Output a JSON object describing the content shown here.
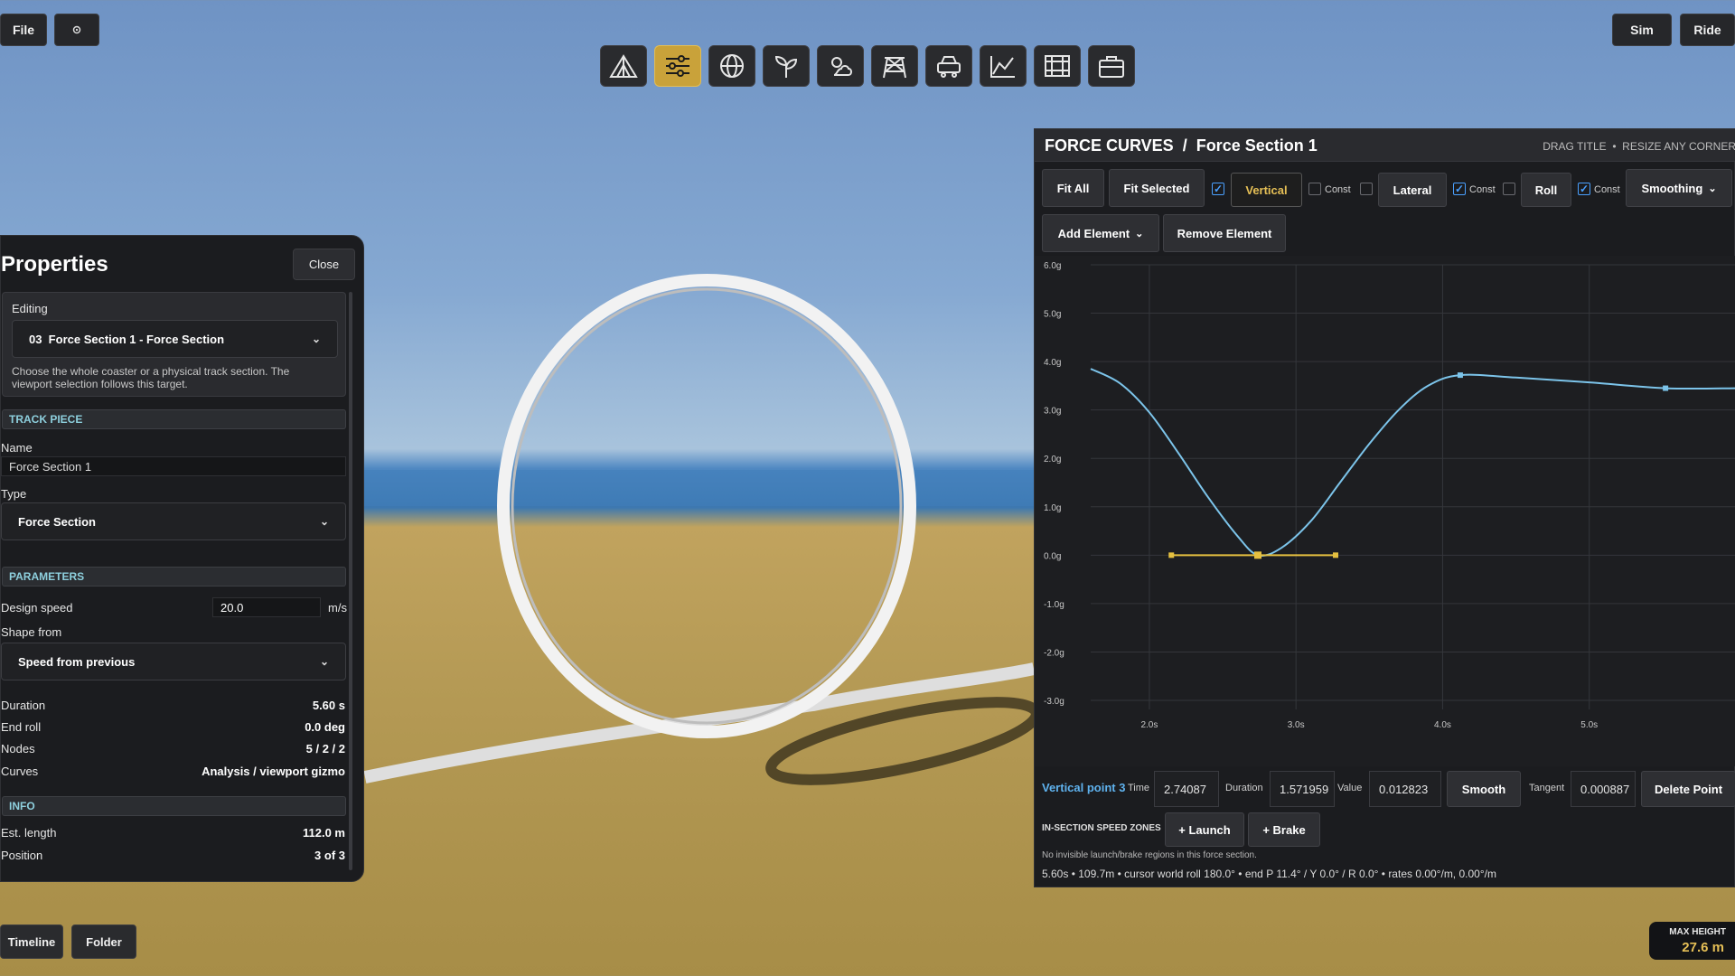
{
  "top": {
    "file_label": "File",
    "sim_label": "Sim",
    "ride_label": "Ride",
    "settings_icon": "gear-icon"
  },
  "toolbar": {
    "tools": [
      {
        "icon": "tent-icon",
        "active": false
      },
      {
        "icon": "sliders-icon",
        "active": true
      },
      {
        "icon": "globe-icon",
        "active": false
      },
      {
        "icon": "plant-icon",
        "active": false
      },
      {
        "icon": "weather-icon",
        "active": false
      },
      {
        "icon": "tower-icon",
        "active": false
      },
      {
        "icon": "car-icon",
        "active": false
      },
      {
        "icon": "graph-icon",
        "active": false
      },
      {
        "icon": "film-icon",
        "active": false
      },
      {
        "icon": "toolbox-icon",
        "active": false
      }
    ],
    "accent": "#c9a23a"
  },
  "properties": {
    "title": "Properties",
    "close_label": "Close",
    "editing_label": "Editing",
    "editing_value": "03  Force Section 1 - Force Section",
    "editing_help": "Choose the whole coaster or a physical track section. The viewport selection follows this target.",
    "track_piece_header": "TRACK PIECE",
    "name_label": "Name",
    "name_value": "Force Section 1",
    "type_label": "Type",
    "type_value": "Force Section",
    "parameters_header": "PARAMETERS",
    "design_speed_label": "Design speed",
    "design_speed_value": "20.0",
    "design_speed_unit": "m/s",
    "shape_from_label": "Shape from",
    "shape_from_value": "Speed from previous",
    "stats": [
      {
        "label": "Duration",
        "value": "5.60 s"
      },
      {
        "label": "End roll",
        "value": "0.0 deg"
      },
      {
        "label": "Nodes",
        "value": "5 / 2 / 2"
      },
      {
        "label": "Curves",
        "value": "Analysis / viewport gizmo"
      }
    ],
    "info_header": "INFO",
    "info": [
      {
        "label": "Est. length",
        "value": "112.0 m"
      },
      {
        "label": "Position",
        "value": "3 of 3"
      }
    ],
    "header_color": "#8ed0de"
  },
  "force_curves": {
    "title": "FORCE CURVES  /  Force Section 1",
    "hint": "DRAG TITLE  •  RESIZE ANY CORNER",
    "fit_all": "Fit All",
    "fit_selected": "Fit Selected",
    "vertical": "Vertical",
    "lateral": "Lateral",
    "roll": "Roll",
    "const": "Const",
    "smoothing": "Smoothing",
    "add_element": "Add Element",
    "remove_element": "Remove Element",
    "checks": {
      "vertical": true,
      "vertical_const": false,
      "lateral": false,
      "lateral_const": true,
      "roll": false,
      "roll_const": true
    },
    "point_label": "Vertical point 3",
    "time_label": "Time",
    "time_value": "2.74087",
    "duration_label": "Duration",
    "duration_value": "1.571959",
    "value_label": "Value",
    "value_value": "0.012823",
    "smooth_label": "Smooth",
    "tangent_label": "Tangent",
    "tangent_value": "0.000887",
    "delete_point": "Delete Point",
    "speed_zones_label": "IN-SECTION SPEED ZONES",
    "launch_label": "+ Launch",
    "brake_label": "+ Brake",
    "no_regions": "No invisible launch/brake regions in this force section.",
    "status_line": "5.60s • 109.7m • cursor world roll 180.0° • end P 11.4° / Y 0.0° / R 0.0° • rates 0.00°/m, 0.00°/m",
    "curve_color": "#7cc4ea",
    "tangent_color": "#e5c040"
  },
  "chart_data": {
    "type": "line",
    "series": [
      {
        "x": [
          1.6,
          1.8,
          2.0,
          2.2,
          2.4,
          2.6,
          2.74,
          2.9,
          3.1,
          3.3,
          3.5,
          3.7,
          3.9,
          4.12,
          4.5,
          5.0,
          5.52,
          6.0
        ],
        "values": [
          3.85,
          3.55,
          2.95,
          2.1,
          1.2,
          0.4,
          0.0,
          0.15,
          0.7,
          1.5,
          2.3,
          3.0,
          3.5,
          3.72,
          3.67,
          3.57,
          3.45,
          3.45
        ]
      }
    ],
    "points": [
      {
        "x": 2.74,
        "y": 0.0,
        "selected": true
      },
      {
        "x": 4.12,
        "y": 3.72,
        "selected": false
      },
      {
        "x": 5.52,
        "y": 3.45,
        "selected": false
      }
    ],
    "tangent_handles": [
      {
        "x": 2.15,
        "y": 0.0
      },
      {
        "x": 3.27,
        "y": 0.0
      }
    ],
    "xticks": [
      "2.0s",
      "3.0s",
      "4.0s",
      "5.0s"
    ],
    "xtick_values": [
      2.0,
      3.0,
      4.0,
      5.0
    ],
    "yticks": [
      "6.0g",
      "5.0g",
      "4.0g",
      "3.0g",
      "2.0g",
      "1.0g",
      "0.0g",
      "-1.0g",
      "-2.0g",
      "-3.0g"
    ],
    "ytick_values": [
      6,
      5,
      4,
      3,
      2,
      1,
      0,
      -1,
      -2,
      -3
    ],
    "xlim": [
      1.6,
      6.0
    ],
    "ylim": [
      -3.0,
      6.0
    ],
    "grid": true
  },
  "bottom": {
    "timeline_label": "Timeline",
    "folder_label": "Folder",
    "max_height_label": "MAX HEIGHT",
    "max_height_value": "27.6 m"
  }
}
